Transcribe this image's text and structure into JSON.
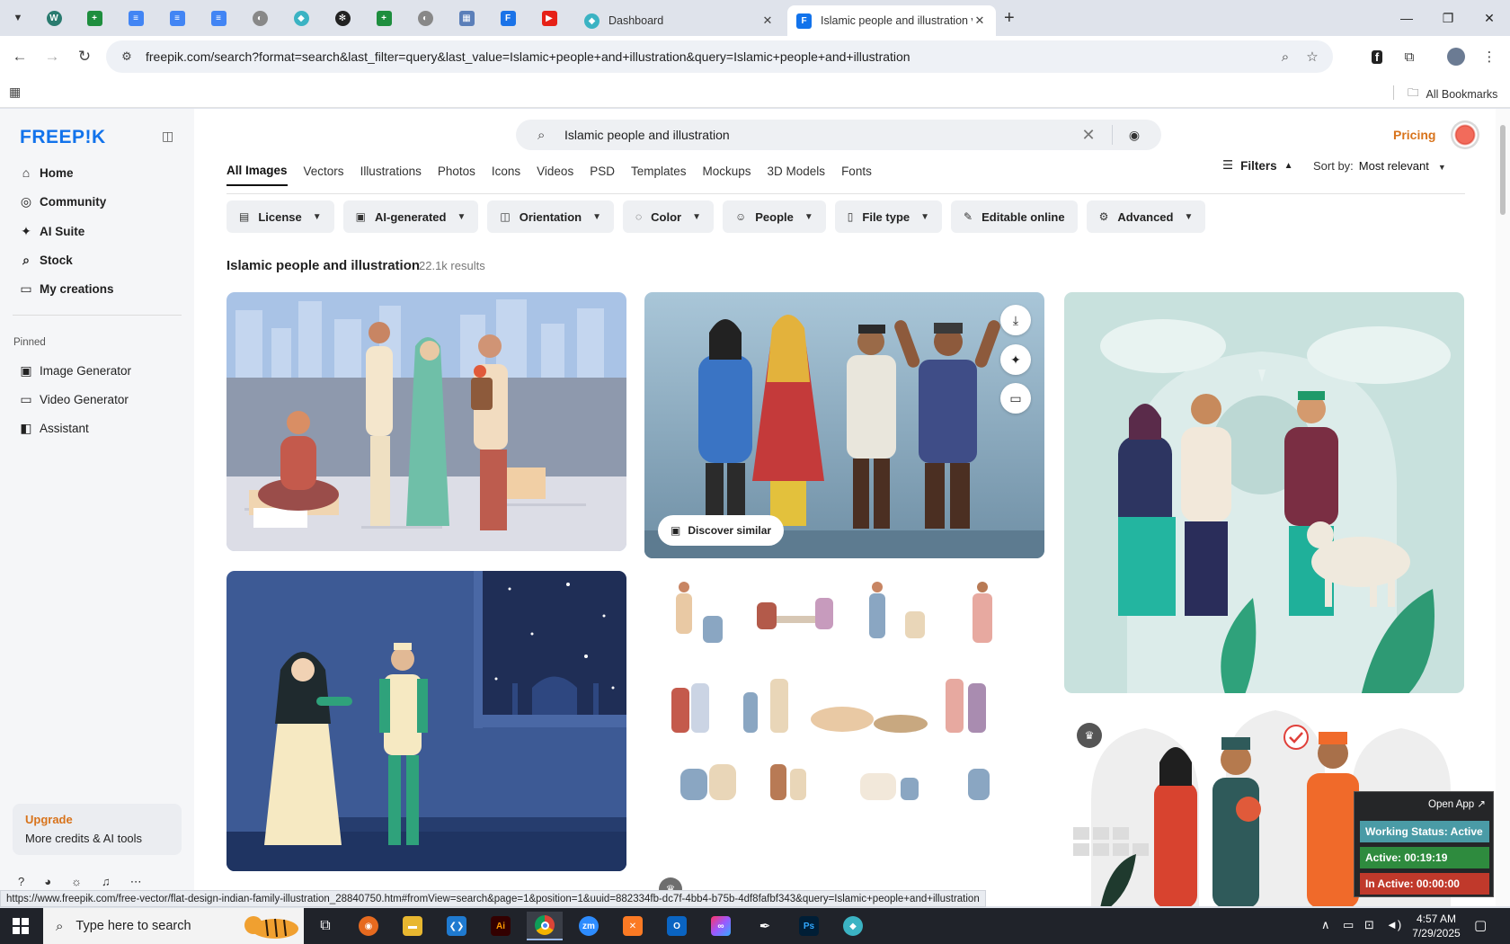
{
  "browser": {
    "tabs": [
      {
        "title": "Dashboard"
      },
      {
        "title": "Islamic people and illustration v"
      }
    ],
    "url": "freepik.com/search?format=search&last_filter=query&last_value=Islamic+people+and+illustration&query=Islamic+people+and+illustration",
    "bookmarks_label": "All Bookmarks"
  },
  "sidebar": {
    "logo": "FREEP!K",
    "nav": [
      {
        "label": "Home",
        "icon": "home-icon"
      },
      {
        "label": "Community",
        "icon": "globe-icon"
      },
      {
        "label": "AI Suite",
        "icon": "sparkle-icon"
      },
      {
        "label": "Stock",
        "icon": "search-icon"
      },
      {
        "label": "My creations",
        "icon": "folder-icon"
      }
    ],
    "pinned_label": "Pinned",
    "pinned": [
      {
        "label": "Image Generator",
        "icon": "image-icon"
      },
      {
        "label": "Video Generator",
        "icon": "video-icon"
      },
      {
        "label": "Assistant",
        "icon": "chat-icon"
      }
    ],
    "upgrade": {
      "title": "Upgrade",
      "subtitle": "More credits & AI tools"
    }
  },
  "header": {
    "search_value": "Islamic people and illustration",
    "pricing": "Pricing"
  },
  "type_tabs": [
    "All Images",
    "Vectors",
    "Illustrations",
    "Photos",
    "Icons",
    "Videos",
    "PSD",
    "Templates",
    "Mockups",
    "3D Models",
    "Fonts"
  ],
  "filters_label": "Filters",
  "sort": {
    "label": "Sort by:",
    "value": "Most relevant"
  },
  "chips": [
    {
      "label": "License",
      "icon": "license-icon"
    },
    {
      "label": "AI-generated",
      "icon": "ai-icon"
    },
    {
      "label": "Orientation",
      "icon": "orientation-icon"
    },
    {
      "label": "Color",
      "icon": "palette-icon"
    },
    {
      "label": "People",
      "icon": "people-icon"
    },
    {
      "label": "File type",
      "icon": "file-icon"
    },
    {
      "label": "Editable online",
      "icon": "edit-icon"
    },
    {
      "label": "Advanced",
      "icon": "gear-icon"
    }
  ],
  "results": {
    "title": "Islamic people and illustration",
    "count": "22.1k results"
  },
  "card_actions": {
    "discover": "Discover similar"
  },
  "status_url": "https://www.freepik.com/free-vector/flat-design-indian-family-illustration_28840750.htm#fromView=search&page=1&position=1&uuid=882334fb-dc7f-4bb4-b75b-4df8fafbf343&query=Islamic+people+and+illustration",
  "tracker": {
    "open_app": "Open App ↗",
    "status": "Working Status: Active",
    "active": "Active: 00:19:19",
    "inactive": "In Active: 00:00:00"
  },
  "taskbar": {
    "search_placeholder": "Type here to search",
    "time": "4:57 AM",
    "date": "7/29/2025"
  },
  "colors": {
    "brand": "#1273eb",
    "accent": "#d8731b",
    "tracker_green": "#2e8b3e",
    "tracker_red": "#c0392b",
    "tracker_teal": "#4a9ba6"
  }
}
